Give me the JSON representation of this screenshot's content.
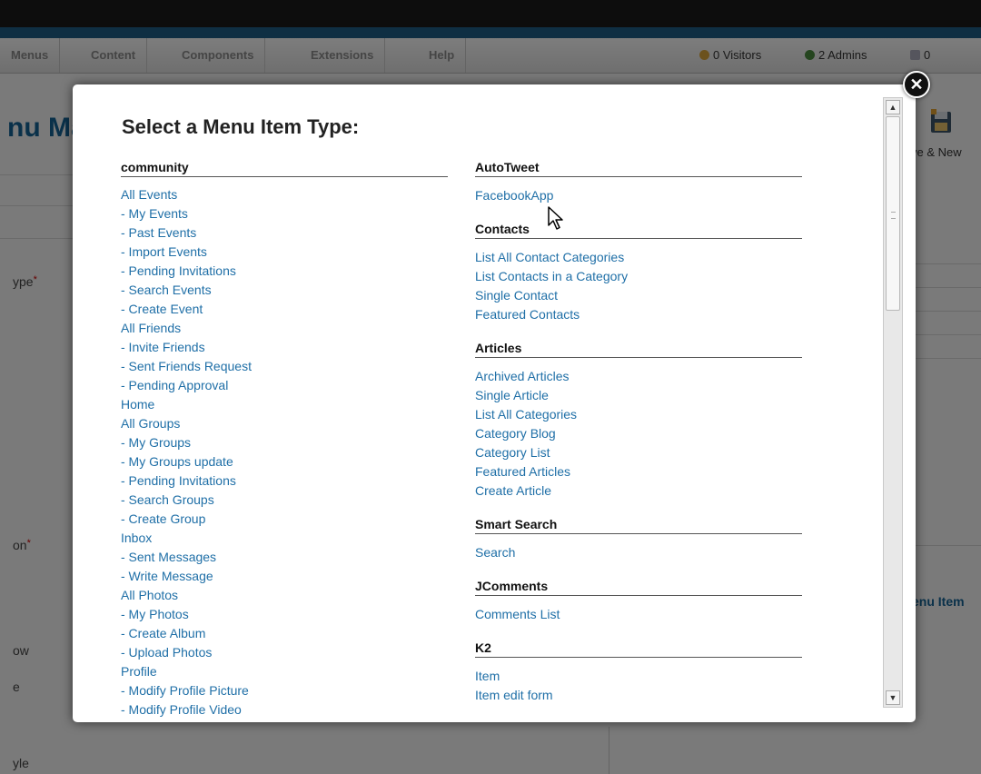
{
  "topbar": {
    "menus": [
      "Menus",
      "Content",
      "Components",
      "Extensions",
      "Help"
    ],
    "visitors": "0 Visitors",
    "admins": "2 Admins",
    "messages": "0"
  },
  "background": {
    "page_title": "nu Ma",
    "save_new": "ve & New",
    "menu_item_label": "enu Item",
    "field_labels": [
      "ype",
      "on",
      "ow",
      "e",
      "yle"
    ]
  },
  "modal": {
    "title": "Select a Menu Item Type:",
    "close_glyph": "✕",
    "left_groups": [
      {
        "heading": "community",
        "items": [
          "All Events",
          "- My Events",
          "- Past Events",
          "- Import Events",
          "- Pending Invitations",
          "- Search Events",
          "- Create Event",
          "All Friends",
          "- Invite Friends",
          "- Sent Friends Request",
          "- Pending Approval",
          "Home",
          "All Groups",
          "- My Groups",
          "- My Groups update",
          "- Pending Invitations",
          "- Search Groups",
          "- Create Group",
          "Inbox",
          "- Sent Messages",
          "- Write Message",
          "All Photos",
          "- My Photos",
          "- Create Album",
          "- Upload Photos",
          "Profile",
          "- Modify Profile Picture",
          "- Modify Profile Video"
        ]
      }
    ],
    "right_groups": [
      {
        "heading": "AutoTweet",
        "items": [
          "FacebookApp"
        ]
      },
      {
        "heading": "Contacts",
        "items": [
          "List All Contact Categories",
          "List Contacts in a Category",
          "Single Contact",
          "Featured Contacts"
        ]
      },
      {
        "heading": "Articles",
        "items": [
          "Archived Articles",
          "Single Article",
          "List All Categories",
          "Category Blog",
          "Category List",
          "Featured Articles",
          "Create Article"
        ]
      },
      {
        "heading": "Smart Search",
        "items": [
          "Search"
        ]
      },
      {
        "heading": "JComments",
        "items": [
          "Comments List"
        ]
      },
      {
        "heading": "K2",
        "items": [
          "Item",
          "Item edit form"
        ]
      }
    ]
  },
  "colors": {
    "link": "#1f6fa7",
    "heading": "#111111",
    "admin_blue": "#146295"
  }
}
